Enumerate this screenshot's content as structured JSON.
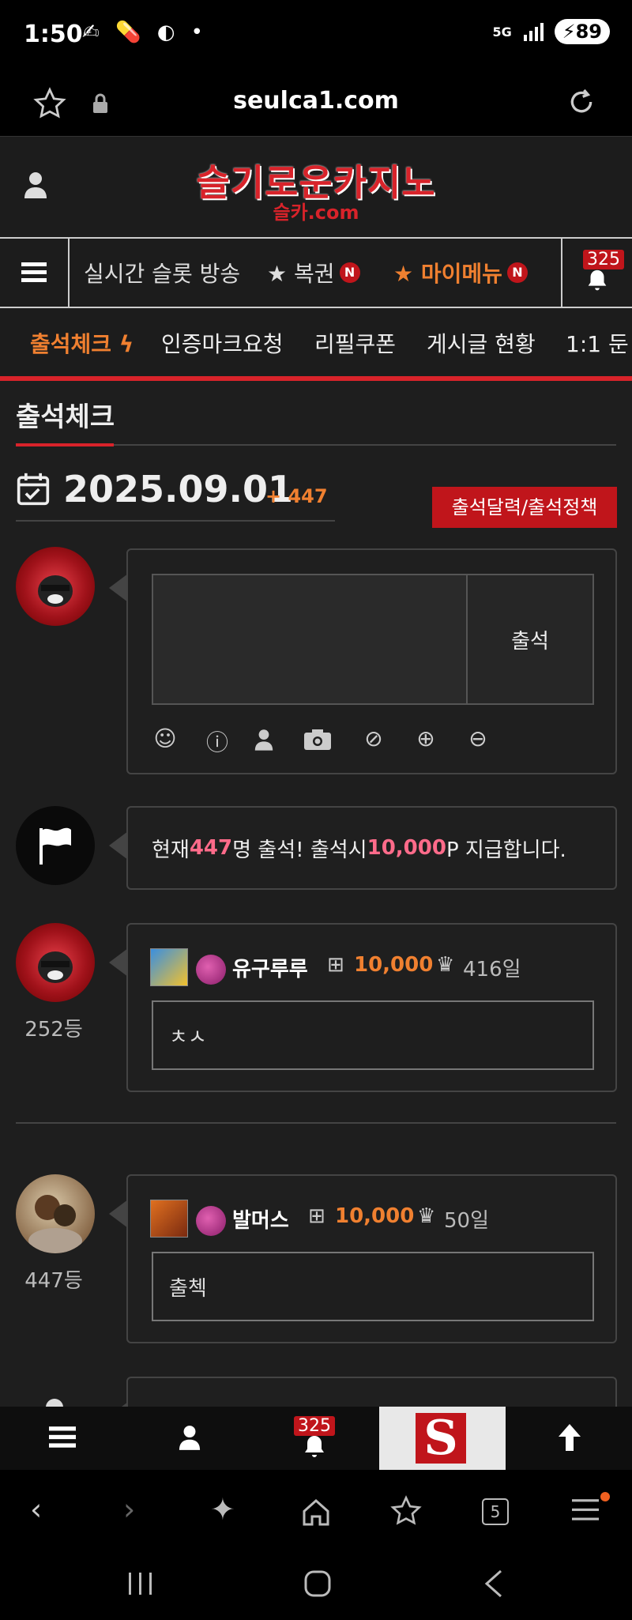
{
  "status": {
    "time": "1:50",
    "notif_icons": "✍ 💊 ◐ •",
    "network": "5G",
    "battery": "89"
  },
  "browser": {
    "url": "seulca1.com"
  },
  "site": {
    "logo_main": "슬기로운카지노",
    "logo_sub": "슬카.com"
  },
  "nav": {
    "live": "실시간 슬롯 방송",
    "lottery": "★ 복권",
    "mymenu": "★ 마이메뉴",
    "n_badge": "N",
    "alert_count": "325"
  },
  "subnav": {
    "items": [
      "출석체크",
      "인증마크요청",
      "리필쿠폰",
      "게시글 현황",
      "1:1 둔"
    ]
  },
  "page": {
    "title": "출석체크",
    "date": "2025.09.01",
    "date_plus": "+ 447",
    "calendar_button": "출석달력/출석정책",
    "attend_button": "출석",
    "notice_prefix": "현재 ",
    "notice_count": "447",
    "notice_mid": "명 출석! 출석시 ",
    "notice_points": "10,000",
    "notice_suffix": "P 지급합니다."
  },
  "entries": [
    {
      "username": "유구루루",
      "points": "10,000",
      "days": "416일",
      "rank": "252등",
      "comment": "ㅊㅅ"
    },
    {
      "username": "발머스",
      "points": "10,000",
      "days": "50일",
      "rank": "447등",
      "comment": "출첵"
    }
  ],
  "bottom_nav": {
    "alert_count": "325"
  },
  "browser_nav": {
    "tab_count": "5"
  },
  "colors": {
    "accent": "#d8232a",
    "orange": "#f08030",
    "pink": "#ff6b8a"
  }
}
